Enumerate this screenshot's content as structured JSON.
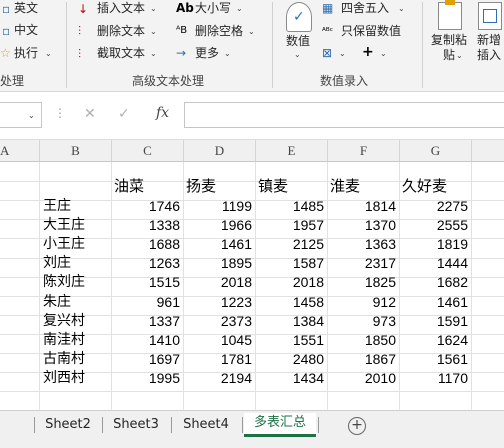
{
  "ribbon": {
    "left_group": {
      "items": [
        "英文",
        "中文",
        "执行"
      ],
      "label": "处理"
    },
    "advanced_text": {
      "items": [
        "插入文本",
        "删除文本",
        "截取文本"
      ],
      "items2": [
        "大小写",
        "删除空格",
        "更多"
      ],
      "label": "高级文本处理"
    },
    "numeric_entry": {
      "numeric_label": "数值",
      "round_label": "四舍五入",
      "keep_value_label": "只保留数值",
      "label": "数值录入"
    },
    "copy_paste": {
      "label": "复制粘贴"
    },
    "new_work": {
      "label": "新增插入"
    }
  },
  "formula_bar": {
    "cancel_icon": "✕",
    "confirm_icon": "✓",
    "fx_label": "fx"
  },
  "grid": {
    "columns": [
      "A",
      "B",
      "C",
      "D",
      "E",
      "F",
      "G"
    ],
    "header_row": [
      "油菜",
      "扬麦",
      "镇麦",
      "淮麦",
      "久好麦"
    ],
    "rows": [
      {
        "name": "王庄",
        "values": [
          1746,
          1199,
          1485,
          1814,
          2275
        ]
      },
      {
        "name": "大王庄",
        "values": [
          1338,
          1966,
          1957,
          1370,
          2555
        ]
      },
      {
        "name": "小王庄",
        "values": [
          1688,
          1461,
          2125,
          1363,
          1819
        ]
      },
      {
        "name": "刘庄",
        "values": [
          1263,
          1895,
          1587,
          2317,
          1444
        ]
      },
      {
        "name": "陈刘庄",
        "values": [
          1515,
          2018,
          2018,
          1825,
          1682
        ]
      },
      {
        "name": "朱庄",
        "values": [
          961,
          1223,
          1458,
          912,
          1461
        ]
      },
      {
        "name": "复兴村",
        "values": [
          1337,
          2373,
          1384,
          973,
          1591
        ]
      },
      {
        "name": "南洼村",
        "values": [
          1410,
          1045,
          1551,
          1850,
          1624
        ]
      },
      {
        "name": "古南村",
        "values": [
          1697,
          1781,
          2480,
          1867,
          1561
        ]
      },
      {
        "name": "刘西村",
        "values": [
          1995,
          2194,
          1434,
          2010,
          1170
        ]
      }
    ]
  },
  "tabs": [
    "Sheet2",
    "Sheet3",
    "Sheet4",
    "多表汇总"
  ],
  "active_tab": "多表汇总",
  "add_sheet_icon": "+"
}
